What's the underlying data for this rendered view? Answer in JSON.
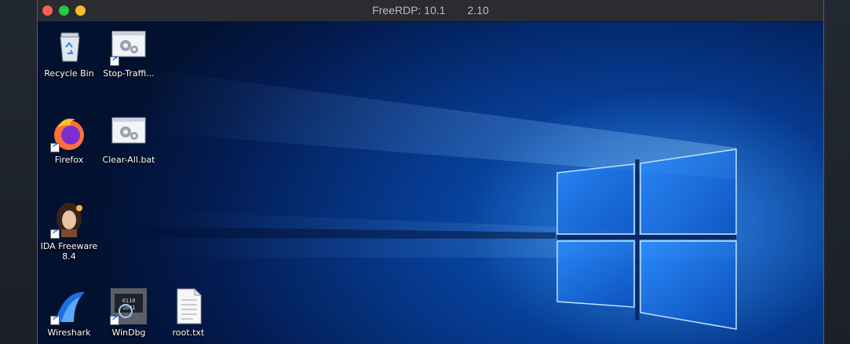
{
  "window": {
    "title": "FreeRDP: 10.1  2.10"
  },
  "desktop": {
    "icons": [
      {
        "label": "Recycle Bin",
        "icon": "recycle-bin-icon"
      },
      {
        "label": "Stop-Traffi...",
        "icon": "batch-file-icon"
      },
      {
        "label": "Firefox",
        "icon": "firefox-icon"
      },
      {
        "label": "Clear-All.bat",
        "icon": "batch-file-icon"
      },
      {
        "label": "IDA Freeware 8.4",
        "icon": "ida-icon"
      },
      {
        "label": "Wireshark",
        "icon": "wireshark-icon"
      },
      {
        "label": "WinDbg",
        "icon": "windbg-icon"
      },
      {
        "label": "root.txt",
        "icon": "text-file-icon"
      }
    ]
  },
  "colors": {
    "close": "#fe5f57",
    "minimize": "#28c840",
    "maximize": "#febc2e",
    "desktop_blue": "#0b5cc4"
  }
}
